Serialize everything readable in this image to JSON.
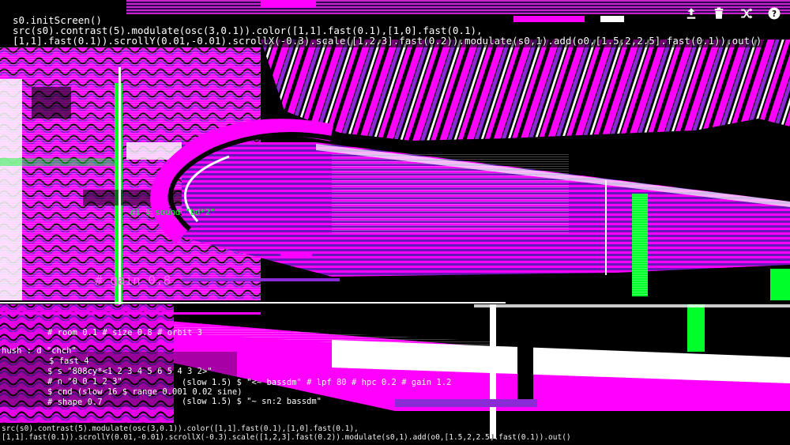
{
  "editor": {
    "lines": [
      "s0.initScreen()",
      "src(s0).contrast(5).modulate(osc(3,0.1)).color([1,1].fast(0.1),[1,0].fast(0.1),",
      "[1,1].fast(0.1)).scrollY(0.01,-0.01).scrollX(-0.3).scale([1,2,3].fast(0.2)).modulate(s0,1).add(o0,[1.5,2,2.5].fast(0.1)).out()"
    ],
    "status": "src(s0).contrast(5).modulate(osc(3,0.1)).color([1,1].fast(0.1),[1,0].fast(0.1),[1,1].fast(0.1)).scrollY(0.01,-0.01).scrollX(-0.3).scale([1,2,3].fast(0.2)).modulate(s0,1).add(o0,[1.5,2,2.5].fast(0.1)).out()"
  },
  "toolbar": {
    "buttons": [
      {
        "icon": "upload-icon",
        "label": "upload"
      },
      {
        "icon": "trash-icon",
        "label": "clear"
      },
      {
        "icon": "shuffle-icon",
        "label": "shuffle"
      },
      {
        "icon": "help-icon",
        "label": "help"
      }
    ]
  },
  "feedback_text": {
    "a": "# gain 0.8",
    "b": "# room 0.1 # size 0.8 # orbit 3",
    "c": "$ fast 4",
    "d": "$ s \"808cy*<1 2 3 4 5 6 5 4 3 2>\"",
    "e": "# n \"0 0 1 2 3\"",
    "f": "$ cnd (slow 16 $ range 0.001 0.02 sine)",
    "g": "# shape 0.7",
    "h": "(slow 1.5) $ \"<~ bassdm\" # lpf 80 # hpc 0.2 # gain 1.2",
    "i": "(slow 1.5) $ \"~ sn:2 bassdm\"",
    "j": "d1 $ sound \"bd*2\"",
    "k": "hush : d \"chch\""
  },
  "colors": {
    "magenta": "#ff00ff",
    "purple": "#8b2bd6",
    "green": "#00ff2a",
    "white": "#ffffff",
    "black": "#000000"
  }
}
